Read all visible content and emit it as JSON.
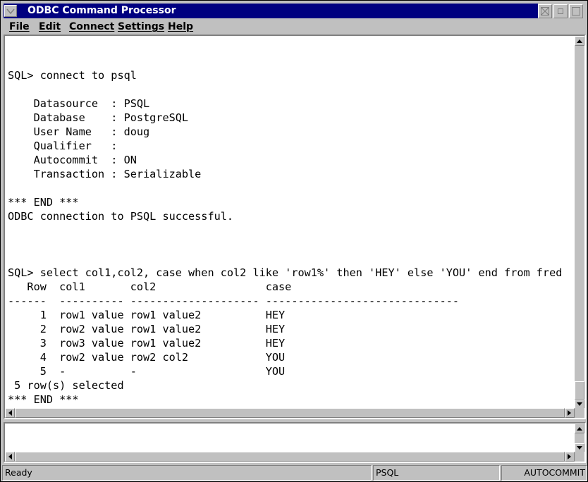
{
  "window": {
    "title": "ODBC Command Processor"
  },
  "menu": [
    "File",
    "Edit",
    "Connect",
    "Settings",
    "Help"
  ],
  "output": {
    "lines": [
      "SQL> connect to psql",
      "",
      "    Datasource  : PSQL",
      "    Database    : PostgreSQL",
      "    User Name   : doug",
      "    Qualifier   :",
      "    Autocommit  : ON",
      "    Transaction : Serializable",
      "",
      "*** END ***",
      "ODBC connection to PSQL successful.",
      "",
      "",
      "",
      "SQL> select col1,col2, case when col2 like 'row1%' then 'HEY' else 'YOU' end from fred",
      "   Row  col1       col2                 case",
      "------  ---------- -------------------- ------------------------------",
      "     1  row1 value row1 value2          HEY",
      "     2  row2 value row1 value2          HEY",
      "     3  row3 value row1 value2          HEY",
      "     4  row2 value row2 col2            YOU",
      "     5  -          -                    YOU",
      " 5 row(s) selected",
      "*** END ***"
    ]
  },
  "input": {
    "value": ""
  },
  "status": {
    "state": "Ready",
    "datasource": "PSQL",
    "mode": "AUTOCOMMIT"
  }
}
